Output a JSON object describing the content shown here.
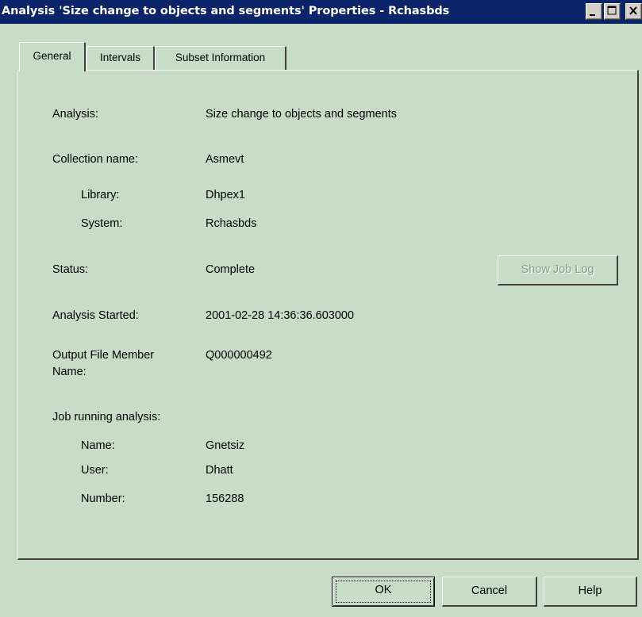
{
  "window": {
    "title": "Analysis 'Size change to objects and segments' Properties - Rchasbds"
  },
  "tabs": [
    {
      "label": "General",
      "selected": true
    },
    {
      "label": "Intervals",
      "selected": false
    },
    {
      "label": "Subset Information",
      "selected": false
    }
  ],
  "general": {
    "analysis_label": "Analysis:",
    "analysis_value": "Size change to objects and segments",
    "collection_label": "Collection name:",
    "collection_value": "Asmevt",
    "library_label": "Library:",
    "library_value": "Dhpex1",
    "system_label": "System:",
    "system_value": "Rchasbds",
    "status_label": "Status:",
    "status_value": "Complete",
    "show_job_log_label": "Show Job Log",
    "started_label": "Analysis Started:",
    "started_value": "2001-02-28 14:36:36.603000",
    "output_label_line1": "Output File Member",
    "output_label_line2": "Name:",
    "output_value": "Q000000492",
    "job_label": "Job running analysis:",
    "job_name_label": "Name:",
    "job_name_value": "Gnetsiz",
    "job_user_label": "User:",
    "job_user_value": "Dhatt",
    "job_number_label": "Number:",
    "job_number_value": "156288"
  },
  "buttons": {
    "ok": "OK",
    "cancel": "Cancel",
    "help": "Help"
  },
  "colors": {
    "titlebar": "#0a246a",
    "background": "#c8dcc8",
    "disabled_text": "#8a9c8a"
  }
}
